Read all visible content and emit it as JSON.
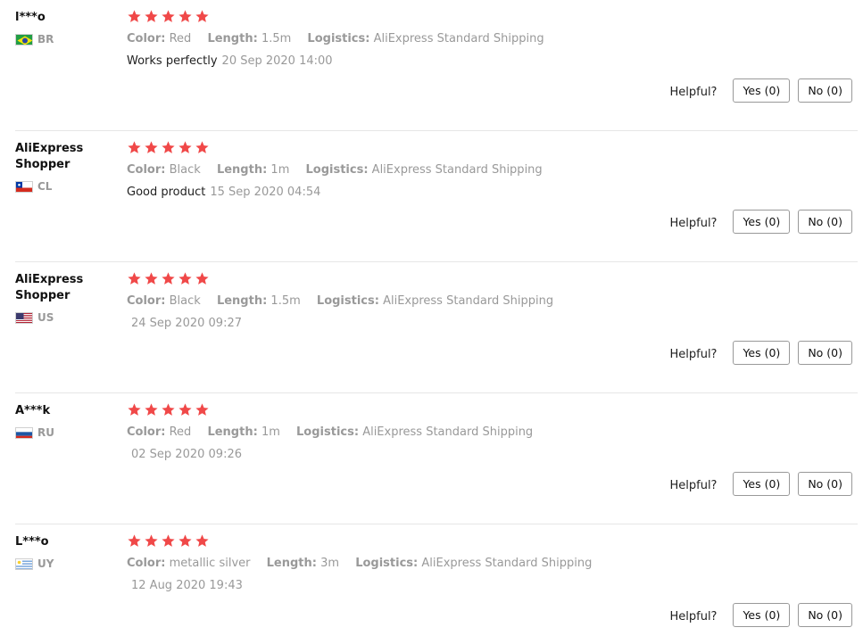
{
  "colors": {
    "star": "#f04848",
    "muted": "#999999",
    "divider": "#e6e6e6"
  },
  "helpful_label": "Helpful?",
  "reviews": [
    {
      "user": "l***o",
      "country": "BR",
      "flag": "brazil-flag-icon",
      "rating": 5,
      "attrs": [
        {
          "key": "Color:",
          "value": "Red"
        },
        {
          "key": "Length:",
          "value": "1.5m"
        },
        {
          "key": "Logistics:",
          "value": "AliExpress Standard Shipping"
        }
      ],
      "text": "Works perfectly",
      "date": "20 Sep 2020 14:00",
      "yes": "Yes (0)",
      "no": "No (0)"
    },
    {
      "user": "AliExpress Shopper",
      "country": "CL",
      "flag": "chile-flag-icon",
      "rating": 5,
      "attrs": [
        {
          "key": "Color:",
          "value": "Black"
        },
        {
          "key": "Length:",
          "value": "1m"
        },
        {
          "key": "Logistics:",
          "value": "AliExpress Standard Shipping"
        }
      ],
      "text": "Good product",
      "date": "15 Sep 2020 04:54",
      "yes": "Yes (0)",
      "no": "No (0)"
    },
    {
      "user": "AliExpress Shopper",
      "country": "US",
      "flag": "usa-flag-icon",
      "rating": 5,
      "attrs": [
        {
          "key": "Color:",
          "value": "Black"
        },
        {
          "key": "Length:",
          "value": "1.5m"
        },
        {
          "key": "Logistics:",
          "value": "AliExpress Standard Shipping"
        }
      ],
      "text": "",
      "date": "24 Sep 2020 09:27",
      "yes": "Yes (0)",
      "no": "No (0)"
    },
    {
      "user": "A***k",
      "country": "RU",
      "flag": "russia-flag-icon",
      "rating": 5,
      "attrs": [
        {
          "key": "Color:",
          "value": "Red"
        },
        {
          "key": "Length:",
          "value": "1m"
        },
        {
          "key": "Logistics:",
          "value": "AliExpress Standard Shipping"
        }
      ],
      "text": "",
      "date": "02 Sep 2020 09:26",
      "yes": "Yes (0)",
      "no": "No (0)"
    },
    {
      "user": "L***o",
      "country": "UY",
      "flag": "uruguay-flag-icon",
      "rating": 5,
      "attrs": [
        {
          "key": "Color:",
          "value": "metallic silver"
        },
        {
          "key": "Length:",
          "value": "3m"
        },
        {
          "key": "Logistics:",
          "value": "AliExpress Standard Shipping"
        }
      ],
      "text": "",
      "date": "12 Aug 2020 19:43",
      "yes": "Yes (0)",
      "no": "No (0)"
    }
  ]
}
